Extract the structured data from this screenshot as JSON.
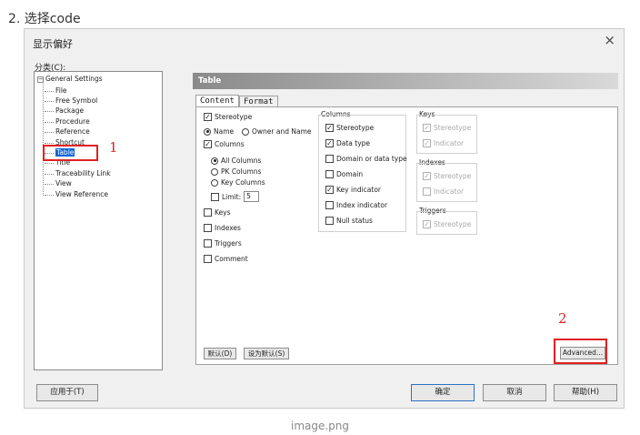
{
  "step_text": "2. 选择code",
  "caption": "image.png",
  "dialog": {
    "title": "显示偏好",
    "close_glyph": "×"
  },
  "category": {
    "label": "分类(C):",
    "root": "General Settings",
    "items": [
      "File",
      "Free Symbol",
      "Package",
      "Procedure",
      "Reference",
      "Shortcut",
      "Table",
      "Title",
      "Traceability Link",
      "View",
      "View Reference"
    ],
    "selected": "Table"
  },
  "annotations": {
    "one": "1",
    "two": "2",
    "annotation_color": "#e02020"
  },
  "header": {
    "title": "Table"
  },
  "tabs": [
    {
      "label": "Content",
      "active": true
    },
    {
      "label": "Format",
      "active": false
    }
  ],
  "content": {
    "stereotype": "Stereotype",
    "name": "Name",
    "owner_and_name": "Owner and Name",
    "columns": "Columns",
    "all_columns": "All Columns",
    "pk_columns": "PK Columns",
    "key_columns": "Key Columns",
    "limit": "Limit:",
    "limit_value": "5",
    "keys": "Keys",
    "indexes": "Indexes",
    "triggers": "Triggers",
    "comment": "Comment"
  },
  "columns_group": {
    "title": "Columns",
    "items": [
      "Stereotype",
      "Data type",
      "Domain or data type",
      "Domain",
      "Key indicator",
      "Index indicator",
      "Null status"
    ],
    "checked": [
      true,
      true,
      false,
      false,
      true,
      false,
      false
    ]
  },
  "keys_group": {
    "title": "Keys",
    "items": [
      "Stereotype",
      "Indicator"
    ]
  },
  "indexes_group": {
    "title": "Indexes",
    "items": [
      "Stereotype",
      "Indicator"
    ]
  },
  "triggers_group": {
    "title": "Triggers",
    "items": [
      "Stereotype"
    ]
  },
  "buttons": {
    "default": "默认(D)",
    "set_default": "设为默认(S)",
    "advanced": "Advanced...",
    "apply_to": "应用于(T)",
    "ok": "确定",
    "cancel": "取消",
    "help": "帮助(H)"
  },
  "colors": {
    "selection": "#0a64d8",
    "header_start": "#8a8a8a",
    "header_end": "#d9d9d9"
  }
}
